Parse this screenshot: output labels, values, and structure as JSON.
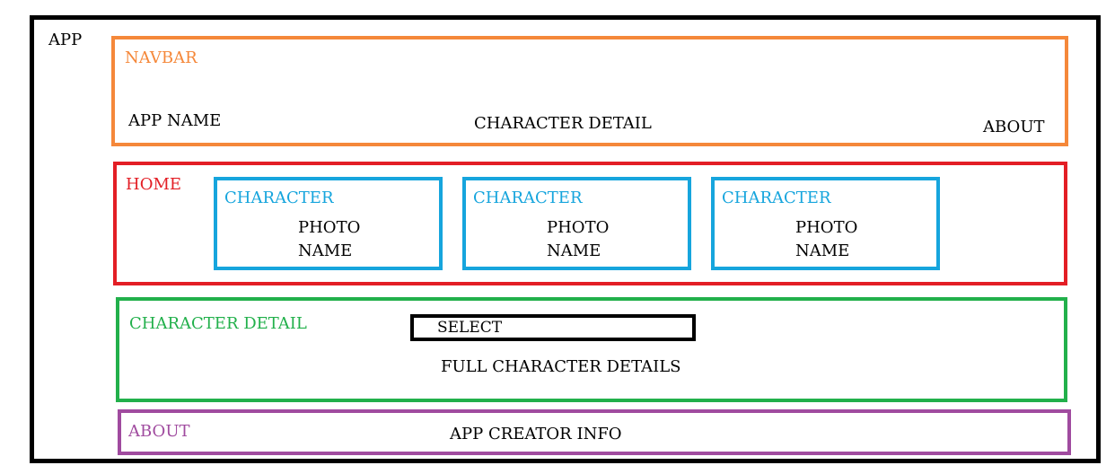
{
  "app": {
    "label": "APP"
  },
  "navbar": {
    "label": "NAVBAR",
    "app_name": "APP NAME",
    "character_detail_link": "CHARACTER DETAIL",
    "about_link": "ABOUT"
  },
  "home": {
    "label": "HOME",
    "cards": [
      {
        "title": "CHARACTER",
        "photo": "PHOTO",
        "name": "NAME"
      },
      {
        "title": "CHARACTER",
        "photo": "PHOTO",
        "name": "NAME"
      },
      {
        "title": "CHARACTER",
        "photo": "PHOTO",
        "name": "NAME"
      }
    ]
  },
  "character_detail": {
    "label": "CHARACTER DETAIL",
    "select_label": "SELECT",
    "body": "FULL CHARACTER DETAILS"
  },
  "about": {
    "label": "ABOUT",
    "body": "APP CREATOR INFO"
  },
  "colors": {
    "app": "#000000",
    "navbar": "#f5883a",
    "home": "#e31e25",
    "character_card": "#16a5dd",
    "character_detail": "#22b04b",
    "about": "#a04b9f"
  }
}
